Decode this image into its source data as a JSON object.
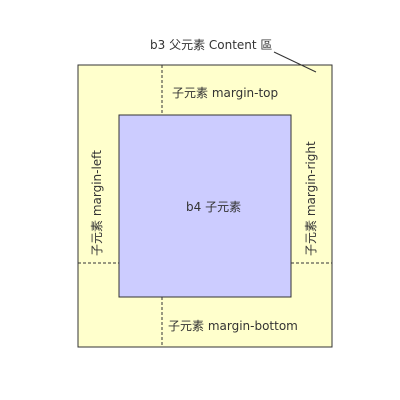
{
  "diagram": {
    "parent_caption": "b3 父元素 Content 區",
    "child_label": "b4 子元素",
    "margin_top_label": "子元素 margin-top",
    "margin_bottom_label": "子元素 margin-bottom",
    "margin_left_label": "子元素 margin-left",
    "margin_right_label": "子元素 margin-right"
  },
  "colors": {
    "parent_fill": "#ffffcc",
    "child_fill": "#ccccff",
    "stroke": "#333333"
  }
}
